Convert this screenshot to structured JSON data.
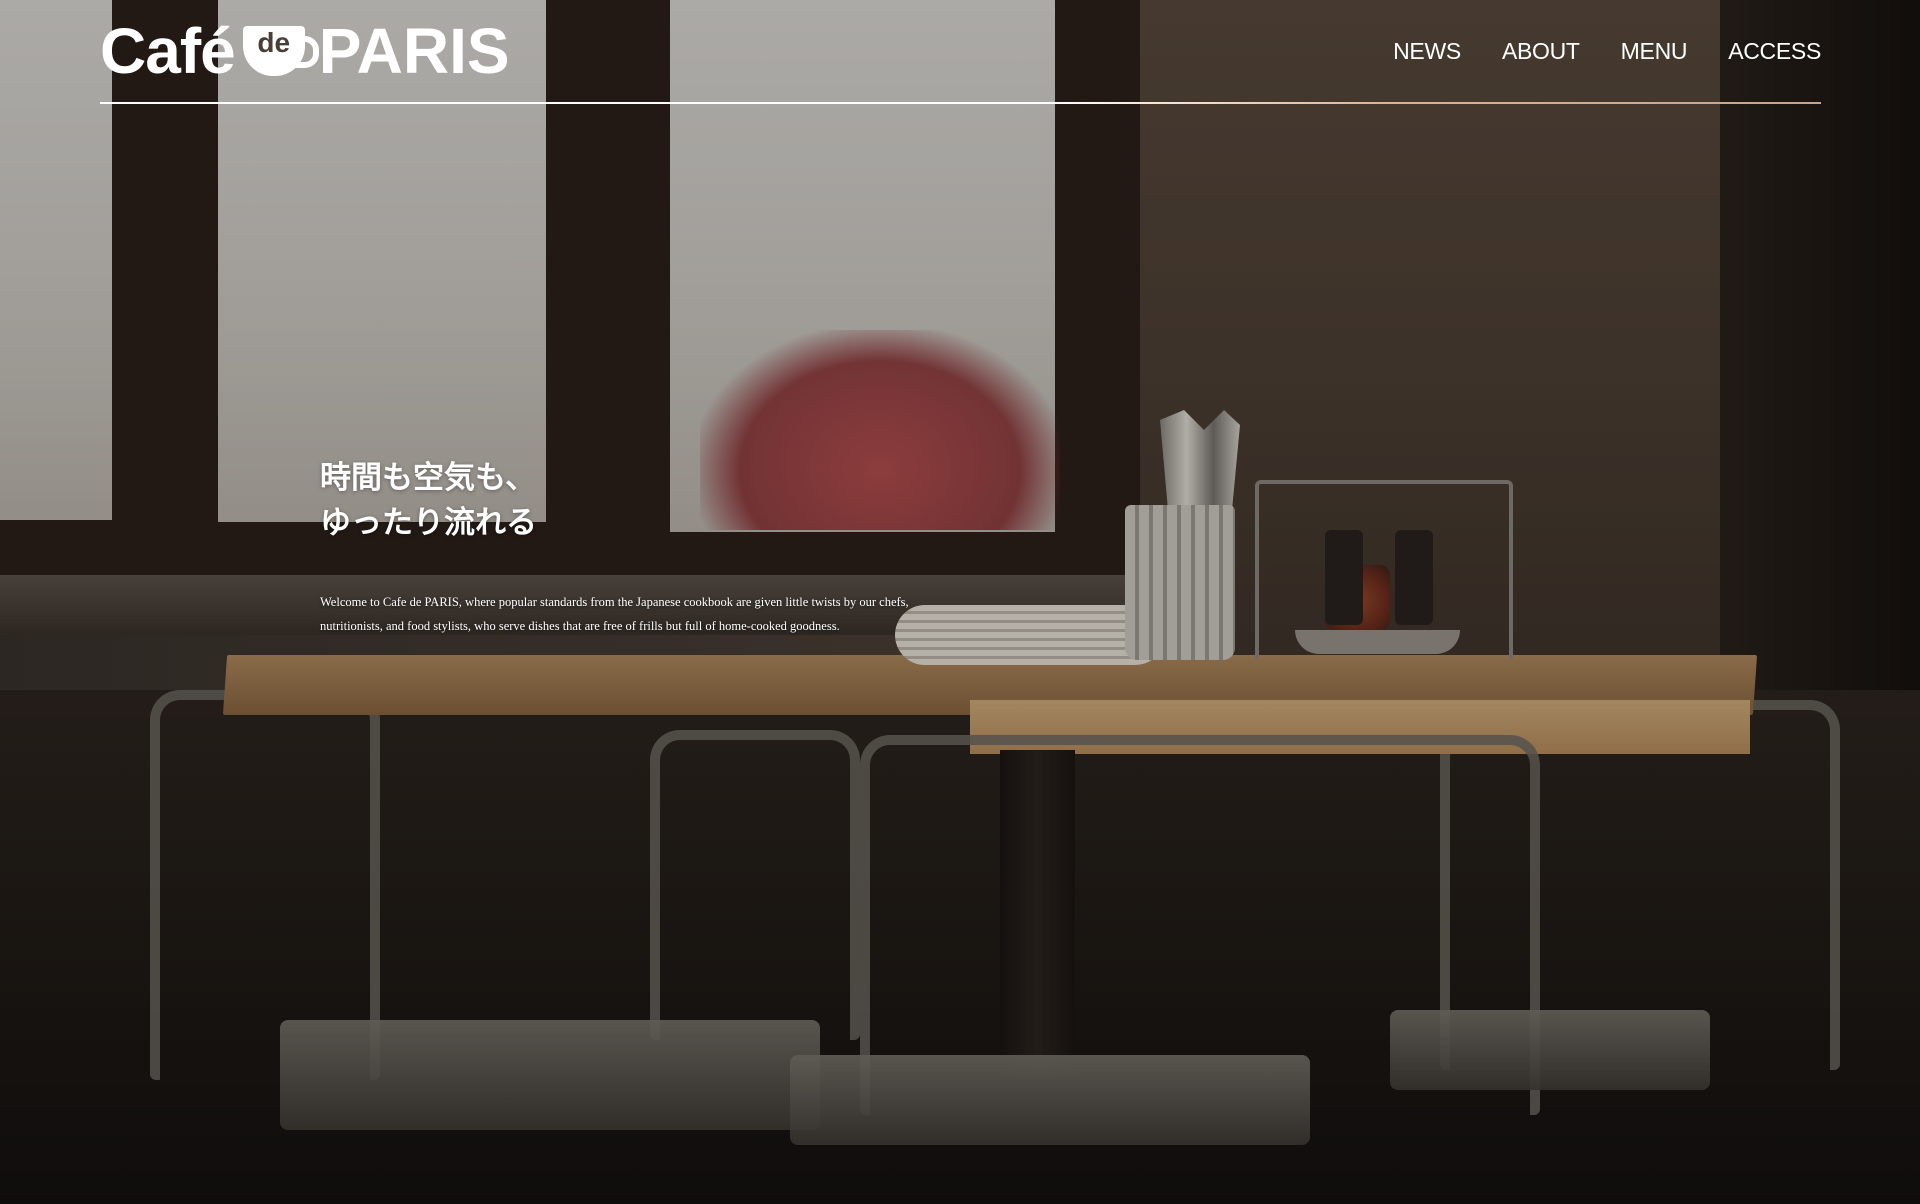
{
  "brand": {
    "logo_cafe": "Café",
    "logo_de": "de",
    "logo_paris": "PARIS"
  },
  "nav": {
    "items": [
      {
        "label": "NEWS"
      },
      {
        "label": "ABOUT"
      },
      {
        "label": "MENU"
      },
      {
        "label": "ACCESS"
      }
    ]
  },
  "hero": {
    "headline_line1": "時間も空気も、",
    "headline_line2": "ゆったり流れる",
    "intro_line1": "Welcome to Cafe de PARIS, where popular standards from the Japanese cookbook are given little twists by our chefs,",
    "intro_line2": "nutritionists, and food stylists, who serve dishes that are free of frills but full of home-cooked goodness."
  }
}
